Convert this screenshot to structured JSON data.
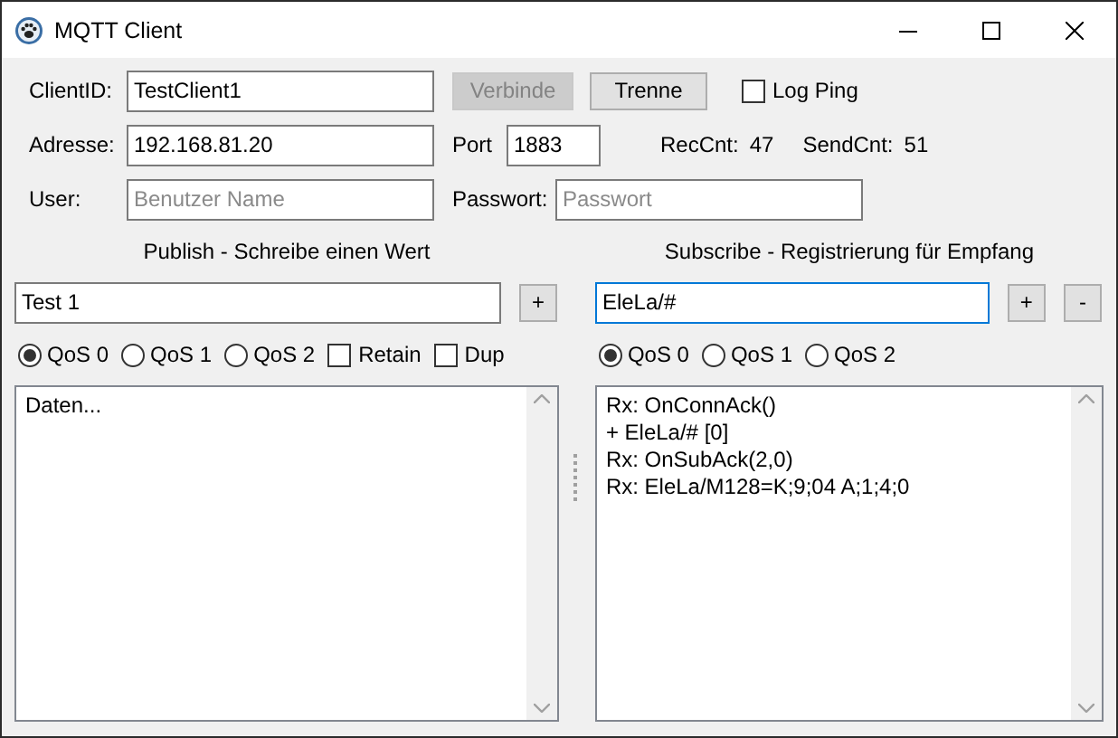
{
  "window": {
    "title": "MQTT Client"
  },
  "connection": {
    "client_id": {
      "label": "ClientID:",
      "value": "TestClient1"
    },
    "connect_button": {
      "label": "Verbinde",
      "disabled": true
    },
    "disconnect_button": {
      "label": "Trenne",
      "disabled": false
    },
    "log_ping": {
      "label": "Log Ping",
      "checked": false
    },
    "address": {
      "label": "Adresse:",
      "value": "192.168.81.20"
    },
    "port": {
      "label": "Port",
      "value": "1883"
    },
    "rec_count": {
      "label": "RecCnt:",
      "value": "47"
    },
    "send_count": {
      "label": "SendCnt:",
      "value": "51"
    },
    "user": {
      "label": "User:",
      "placeholder": "Benutzer Name"
    },
    "password": {
      "label": "Passwort:",
      "placeholder": "Passwort"
    }
  },
  "publish": {
    "title": "Publish - Schreibe einen Wert",
    "topic": {
      "value": "Test 1",
      "focused": false
    },
    "buttons": [
      "+"
    ],
    "options": [
      {
        "kind": "radio",
        "label": "QoS 0",
        "selected": true
      },
      {
        "kind": "radio",
        "label": "QoS 1",
        "selected": false
      },
      {
        "kind": "radio",
        "label": "QoS 2",
        "selected": false
      },
      {
        "kind": "checkbox",
        "label": "Retain",
        "checked": false
      },
      {
        "kind": "checkbox",
        "label": "Dup",
        "checked": false
      }
    ],
    "data": [
      "Daten..."
    ]
  },
  "subscribe": {
    "title": "Subscribe - Registrierung für Empfang",
    "topic": {
      "value": "EleLa/#",
      "focused": true
    },
    "buttons": [
      "+",
      "-"
    ],
    "options": [
      {
        "kind": "radio",
        "label": "QoS 0",
        "selected": true
      },
      {
        "kind": "radio",
        "label": "QoS 1",
        "selected": false
      },
      {
        "kind": "radio",
        "label": "QoS 2",
        "selected": false
      }
    ],
    "data": [
      "Rx: OnConnAck()",
      "+ EleLa/# [0]",
      "Rx: OnSubAck(2,0)",
      "Rx: EleLa/M128=K;9;04 A;1;4;0"
    ]
  }
}
